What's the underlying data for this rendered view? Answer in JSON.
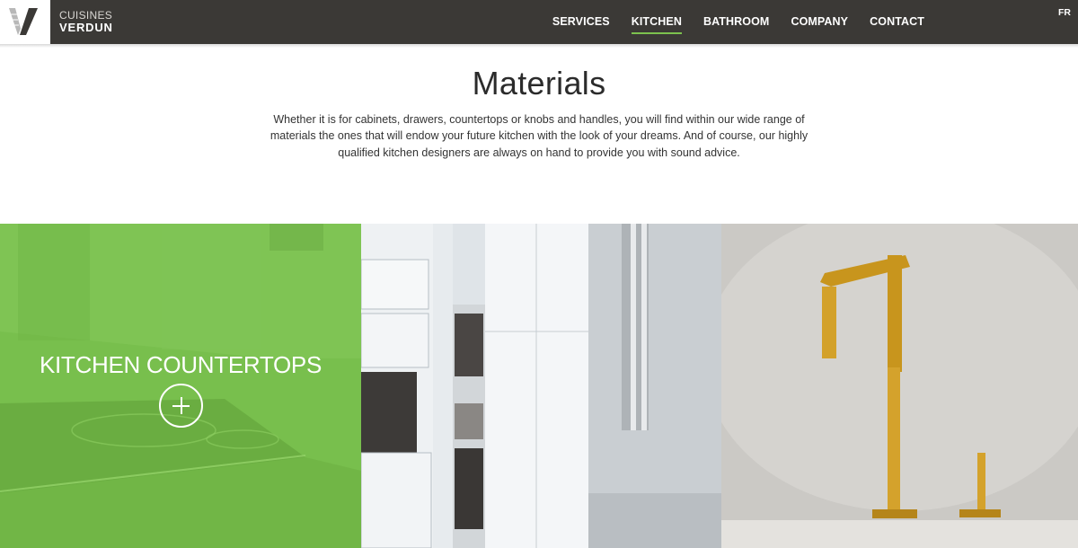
{
  "brand": {
    "line1": "CUISINES",
    "line2": "VERDUN",
    "logo_icon": "v-logo-icon"
  },
  "nav": {
    "items": [
      {
        "label": "SERVICES",
        "active": false
      },
      {
        "label": "KITCHEN",
        "active": true
      },
      {
        "label": "BATHROOM",
        "active": false
      },
      {
        "label": "COMPANY",
        "active": false
      },
      {
        "label": "CONTACT",
        "active": false
      }
    ],
    "lang": "FR"
  },
  "intro": {
    "title": "Materials",
    "text": "Whether it is for cabinets, drawers, countertops or knobs and handles, you will find within our wide range of materials the ones that will endow your future kitchen with the look of your dreams. And of course, our highly qualified kitchen designers are always on hand to provide you with sound advice."
  },
  "tiles": [
    {
      "label": "KITCHEN COUNTERTOPS",
      "icon": "plus-circle-icon",
      "image": "countertop-photo"
    },
    {
      "image": "white-cabinets-photo"
    },
    {
      "image": "gold-faucet-photo"
    }
  ],
  "colors": {
    "header": "#3b3936",
    "accent": "#7ac04f",
    "nav_underline": "#7cc24e",
    "text": "#2b2b2b"
  }
}
